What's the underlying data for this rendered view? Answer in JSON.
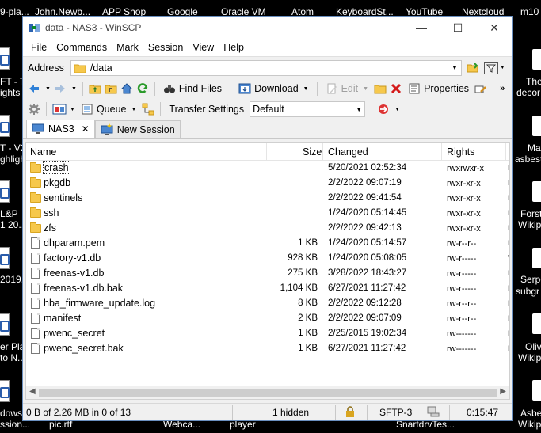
{
  "desktop": {
    "top_labels": [
      "9-pla...",
      "John.Newb...",
      "APP Shop",
      "Google",
      "Oracle VM",
      "Atom",
      "KeyboardSt...",
      "YouTube",
      "Nextcloud",
      "m10"
    ],
    "left_labels": [
      "FT - T",
      "ights",
      "T - V2",
      "ghligh",
      "L&P",
      "1 20...",
      "2019.",
      "er Pla",
      "to N...",
      "dows",
      "ssion..."
    ],
    "right_labels": [
      "The",
      "decor",
      "Ma",
      "asbest",
      "Forst",
      "Wikip",
      "Serpe",
      "subgr",
      "Oliv",
      "Wikip",
      "Asbe",
      "Wikip"
    ],
    "bottom_labels": [
      "pic.rtf",
      "Webca...",
      "player",
      "SnartdrvTes..."
    ]
  },
  "window": {
    "title": "data - NAS3 - WinSCP",
    "controls": {
      "minimize": "—",
      "maximize": "☐",
      "close": "✕"
    }
  },
  "menu": [
    "File",
    "Commands",
    "Mark",
    "Session",
    "View",
    "Help"
  ],
  "address": {
    "label": "Address",
    "path": "/data"
  },
  "toolbar1": {
    "find_files": "Find Files",
    "download": "Download",
    "edit": "Edit",
    "properties": "Properties"
  },
  "toolbar2": {
    "queue": "Queue",
    "transfer_settings_label": "Transfer Settings",
    "transfer_settings_value": "Default"
  },
  "tabs": [
    {
      "label": "NAS3",
      "active": true
    },
    {
      "label": "New Session",
      "active": false
    }
  ],
  "columns": {
    "name": "Name",
    "size": "Size",
    "changed": "Changed",
    "rights": "Rights"
  },
  "files": [
    {
      "name": "crash",
      "size": "",
      "changed": "5/20/2021 02:52:34",
      "rights": "rwxrwxr-x",
      "owner": "r",
      "type": "folder"
    },
    {
      "name": "pkgdb",
      "size": "",
      "changed": "2/2/2022 09:07:19",
      "rights": "rwxr-xr-x",
      "owner": "r",
      "type": "folder"
    },
    {
      "name": "sentinels",
      "size": "",
      "changed": "2/2/2022 09:41:54",
      "rights": "rwxr-xr-x",
      "owner": "r",
      "type": "folder"
    },
    {
      "name": "ssh",
      "size": "",
      "changed": "1/24/2020 05:14:45",
      "rights": "rwxr-xr-x",
      "owner": "r",
      "type": "folder"
    },
    {
      "name": "zfs",
      "size": "",
      "changed": "2/2/2022 09:42:13",
      "rights": "rwxr-xr-x",
      "owner": "r",
      "type": "folder"
    },
    {
      "name": "dhparam.pem",
      "size": "1 KB",
      "changed": "1/24/2020 05:14:57",
      "rights": "rw-r--r--",
      "owner": "r",
      "type": "file"
    },
    {
      "name": "factory-v1.db",
      "size": "928 KB",
      "changed": "1/24/2020 05:08:05",
      "rights": "rw-r-----",
      "owner": "v",
      "type": "file"
    },
    {
      "name": "freenas-v1.db",
      "size": "275 KB",
      "changed": "3/28/2022 18:43:27",
      "rights": "rw-r-----",
      "owner": "r",
      "type": "file"
    },
    {
      "name": "freenas-v1.db.bak",
      "size": "1,104 KB",
      "changed": "6/27/2021 11:27:42",
      "rights": "rw-r-----",
      "owner": "r",
      "type": "file"
    },
    {
      "name": "hba_firmware_update.log",
      "size": "8 KB",
      "changed": "2/2/2022 09:12:28",
      "rights": "rw-r--r--",
      "owner": "r",
      "type": "file"
    },
    {
      "name": "manifest",
      "size": "2 KB",
      "changed": "2/2/2022 09:07:09",
      "rights": "rw-r--r--",
      "owner": "r",
      "type": "file"
    },
    {
      "name": "pwenc_secret",
      "size": "1 KB",
      "changed": "2/25/2015 19:02:34",
      "rights": "rw-------",
      "owner": "r",
      "type": "file"
    },
    {
      "name": "pwenc_secret.bak",
      "size": "1 KB",
      "changed": "6/27/2021 11:27:42",
      "rights": "rw-------",
      "owner": "r",
      "type": "file"
    }
  ],
  "status": {
    "selection": "0 B of 2.26 MB in 0 of 13",
    "hidden": "1 hidden",
    "protocol": "SFTP-3",
    "time": "0:15:47"
  }
}
